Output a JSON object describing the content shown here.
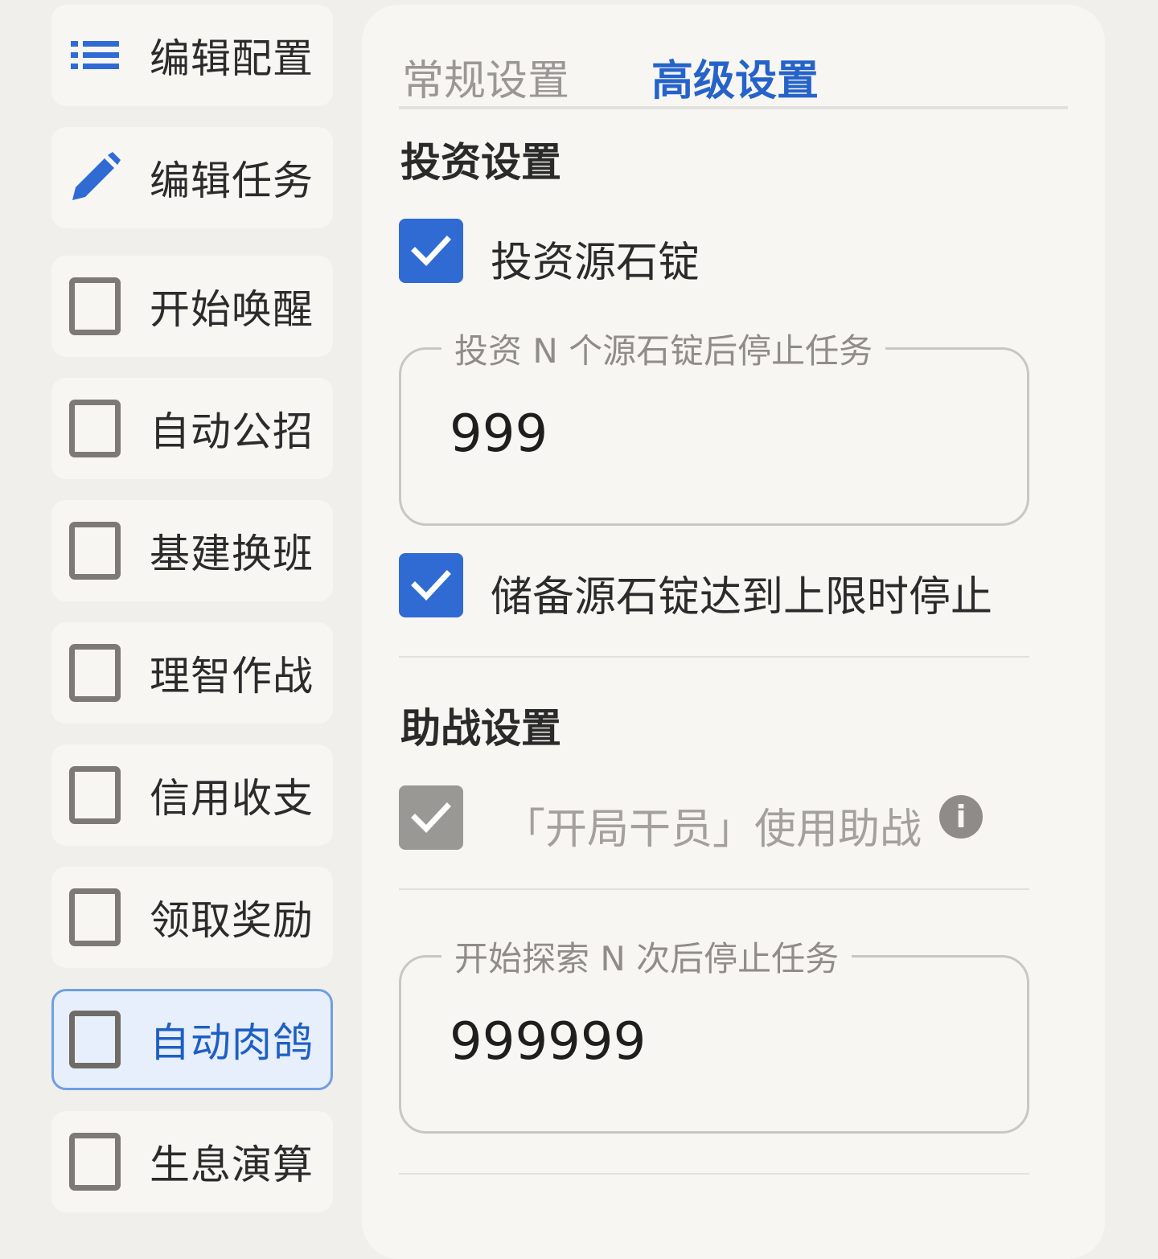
{
  "sidebar": {
    "items": [
      {
        "label": "编辑配置",
        "icon": "list-icon"
      },
      {
        "label": "编辑任务",
        "icon": "pencil-icon"
      },
      {
        "label": "开始唤醒",
        "checked": false
      },
      {
        "label": "自动公招",
        "checked": false
      },
      {
        "label": "基建换班",
        "checked": false
      },
      {
        "label": "理智作战",
        "checked": false
      },
      {
        "label": "信用收支",
        "checked": false
      },
      {
        "label": "领取奖励",
        "checked": false
      },
      {
        "label": "自动肉鸽",
        "checked": false,
        "active": true
      },
      {
        "label": "生息演算",
        "checked": false
      }
    ]
  },
  "tabs": {
    "normal": "常规设置",
    "advanced": "高级设置",
    "selected": "advanced"
  },
  "invest": {
    "title": "投资设置",
    "invest_checkbox": {
      "label": "投资源石锭",
      "checked": true
    },
    "stop_after": {
      "label": "投资 N 个源石锭后停止任务",
      "value": "999"
    },
    "stop_at_limit": {
      "label": "储备源石锭达到上限时停止",
      "checked": true
    }
  },
  "support": {
    "title": "助战设置",
    "use_support": {
      "label": "「开局干员」使用助战",
      "checked": true,
      "disabled": true
    },
    "info_glyph": "i"
  },
  "explore": {
    "stop_after": {
      "label": "开始探索 N 次后停止任务",
      "value": "999999"
    }
  },
  "colors": {
    "accent": "#2f6bd3",
    "active_tab": "#2563c9",
    "active_border": "#6f9fe0",
    "active_bg": "#e6effb",
    "disabled": "#9a9895",
    "background": "#f0efec",
    "panel": "#f7f6f3"
  }
}
